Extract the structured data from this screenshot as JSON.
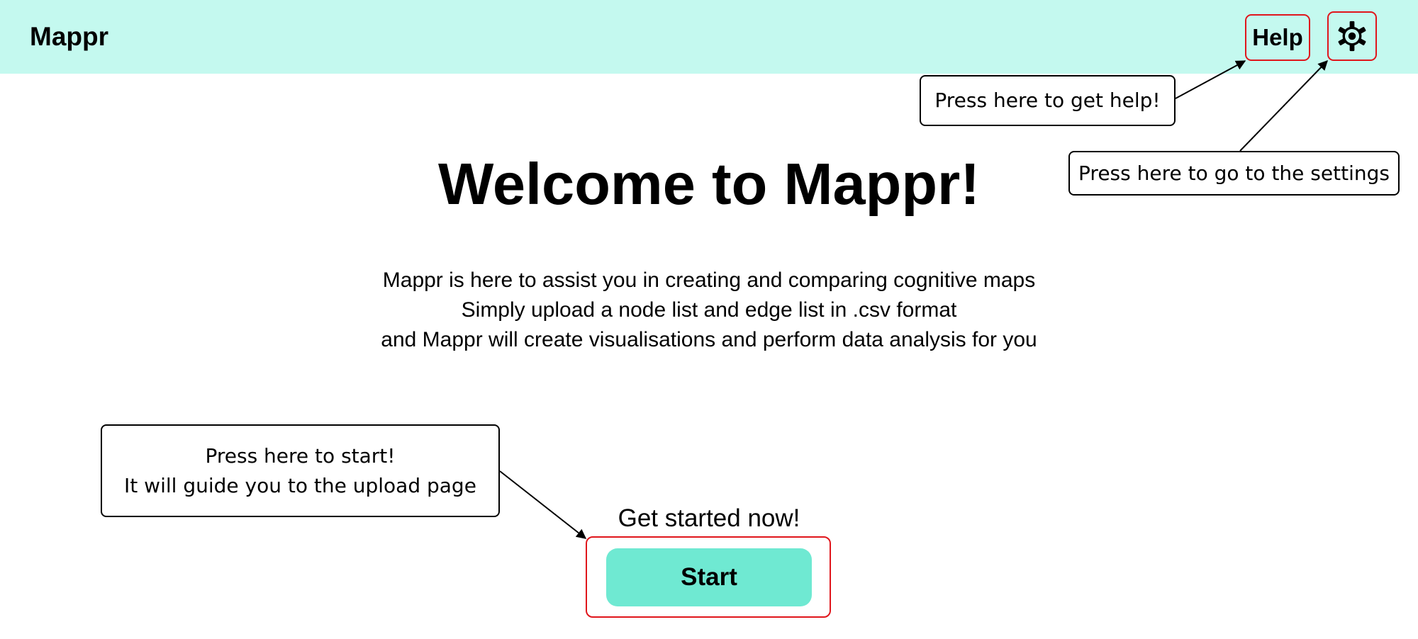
{
  "header": {
    "app_title": "Mappr",
    "help_label": "Help",
    "settings_icon": "gear-icon"
  },
  "main": {
    "welcome_title": "Welcome to Mappr!",
    "intro_lines": [
      "Mappr is here to assist you in creating and comparing cognitive maps",
      "Simply upload a node list and edge list in .csv format",
      "and Mappr will create visualisations and perform data analysis for you"
    ],
    "get_started_text": "Get started now!",
    "start_label": "Start"
  },
  "callouts": {
    "help": "Press here to get help!",
    "settings": "Press here to go to the settings",
    "start_lines": [
      "Press here to start!",
      "It will guide you to the upload page"
    ]
  },
  "colors": {
    "topbar_background": "#c4f9ef",
    "start_button": "#6fe9d2",
    "highlight_border": "#e0161c"
  }
}
